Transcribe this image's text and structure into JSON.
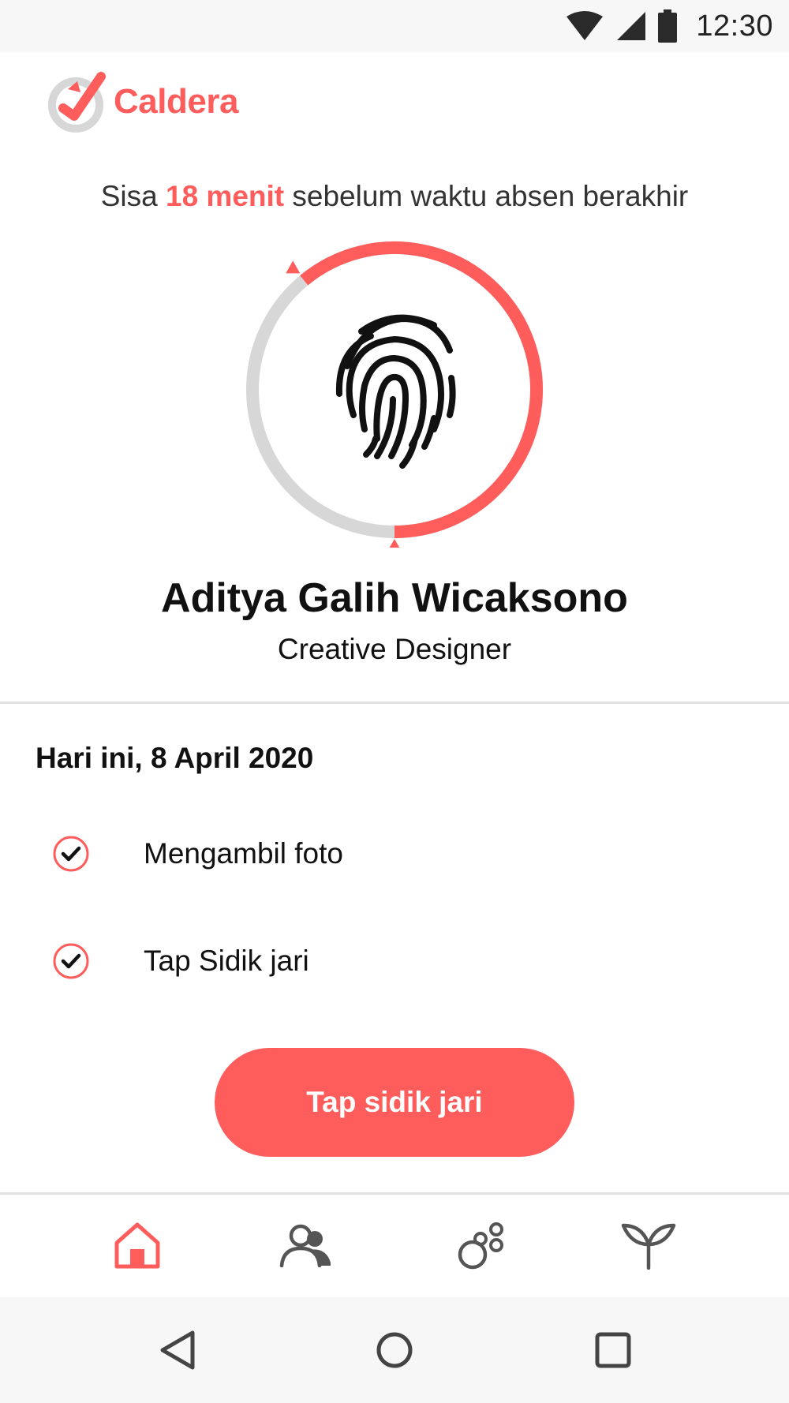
{
  "status_bar": {
    "time": "12:30",
    "icons": [
      "wifi-icon",
      "signal-icon",
      "battery-icon"
    ]
  },
  "app": {
    "brand_name": "Caldera",
    "accent_color": "#ff5c5c"
  },
  "countdown": {
    "prefix": "Sisa ",
    "highlight": "18 menit",
    "suffix": " sebelum waktu absen berakhir"
  },
  "timer_ring": {
    "remaining_fraction": 0.61,
    "icon": "fingerprint-icon"
  },
  "profile": {
    "name": "Aditya Galih Wicaksono",
    "role": "Creative Designer"
  },
  "today": {
    "heading": "Hari ini, 8 April 2020",
    "checklist": [
      {
        "label": "Mengambil foto",
        "done": true
      },
      {
        "label": "Tap Sidik jari",
        "done": true
      }
    ]
  },
  "primary_action": {
    "label": "Tap sidik jari"
  },
  "bottom_nav": {
    "items": [
      {
        "icon": "home-icon",
        "active": true
      },
      {
        "icon": "people-icon",
        "active": false
      },
      {
        "icon": "circles-icon",
        "active": false
      },
      {
        "icon": "sprout-icon",
        "active": false
      }
    ]
  },
  "system_nav": {
    "buttons": [
      "back-icon",
      "home-circle-icon",
      "recents-icon"
    ]
  }
}
